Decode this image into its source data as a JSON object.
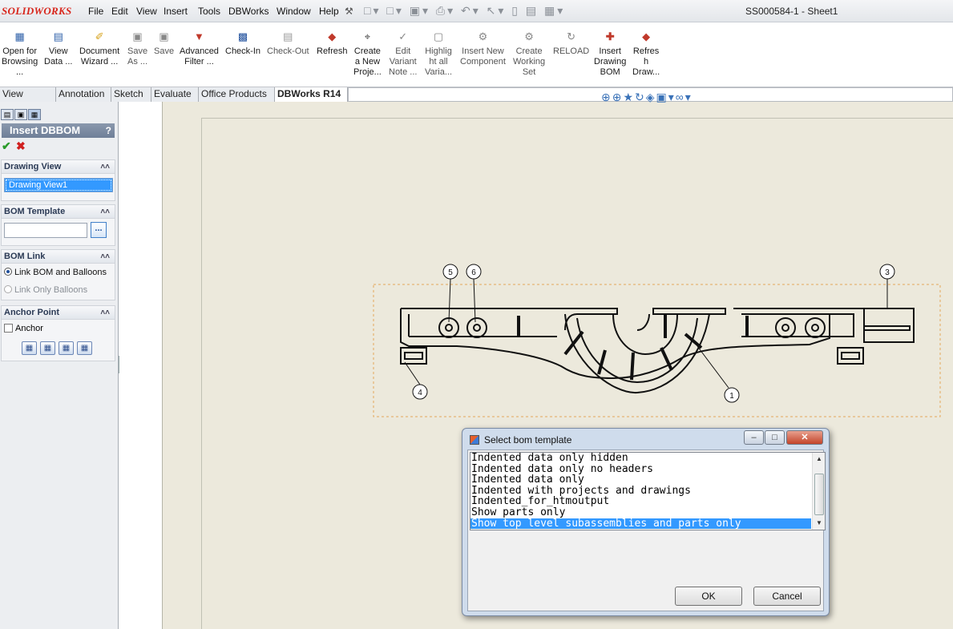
{
  "app": {
    "logo": "SOLIDWORKS",
    "document_title": "SS000584-1 - Sheet1"
  },
  "menu": [
    "File",
    "Edit",
    "View",
    "Insert",
    "Tools",
    "DBWorks",
    "Window",
    "Help"
  ],
  "commands": [
    {
      "label": "Open for\nBrowsing\n...",
      "icon": "open-browse-icon"
    },
    {
      "label": "View\nData ...",
      "icon": "view-data-icon"
    },
    {
      "label": "Document\nWizard ...",
      "icon": "document-wizard-icon"
    },
    {
      "label": "Save\nAs ...",
      "icon": "save-as-icon"
    },
    {
      "label": "Save",
      "icon": "save-icon"
    },
    {
      "label": "Advanced\nFilter ...",
      "icon": "filter-icon"
    },
    {
      "label": "Check-In",
      "icon": "check-in-icon"
    },
    {
      "label": "Check-Out",
      "icon": "check-out-icon"
    },
    {
      "label": "Refresh",
      "icon": "refresh-icon"
    },
    {
      "label": "Create\na New\nProje...",
      "icon": "create-project-icon"
    },
    {
      "label": "Edit\nVariant\nNote ...",
      "icon": "edit-variant-icon"
    },
    {
      "label": "Highlig\nht all\nVaria...",
      "icon": "highlight-icon"
    },
    {
      "label": "Insert New\nComponent",
      "icon": "insert-component-icon"
    },
    {
      "label": "Create\nWorking\nSet",
      "icon": "working-set-icon"
    },
    {
      "label": "RELOAD",
      "icon": "reload-icon"
    },
    {
      "label": "Insert\nDrawing\nBOM",
      "icon": "insert-bom-icon"
    },
    {
      "label": "Refres\nh\nDraw...",
      "icon": "refresh-bom-icon"
    }
  ],
  "tabs": [
    "View Layout",
    "Annotation",
    "Sketch",
    "Evaluate",
    "Office Products",
    "DBWorks R14"
  ],
  "property_manager": {
    "title": "Insert DBBOM",
    "help": "?",
    "drawing_view": {
      "header": "Drawing View",
      "value": "Drawing View1"
    },
    "bom_template": {
      "header": "BOM Template",
      "value": "",
      "browse": "..."
    },
    "bom_link": {
      "header": "BOM Link",
      "option1": "Link BOM and Balloons",
      "option2": "Link Only Balloons"
    },
    "anchor_point": {
      "header": "Anchor Point",
      "checkbox": "Anchor"
    }
  },
  "balloons": [
    "5",
    "6",
    "3",
    "4",
    "1"
  ],
  "dialog": {
    "title": "Select bom template",
    "items": [
      "Indented data only hidden",
      "Indented data only no headers",
      "Indented data only",
      "Indented with projects and drawings",
      "Indented_for_htmoutput",
      "Show parts only",
      "Show top level subassemblies and parts only"
    ],
    "selected_index": 6,
    "ok": "OK",
    "cancel": "Cancel"
  }
}
